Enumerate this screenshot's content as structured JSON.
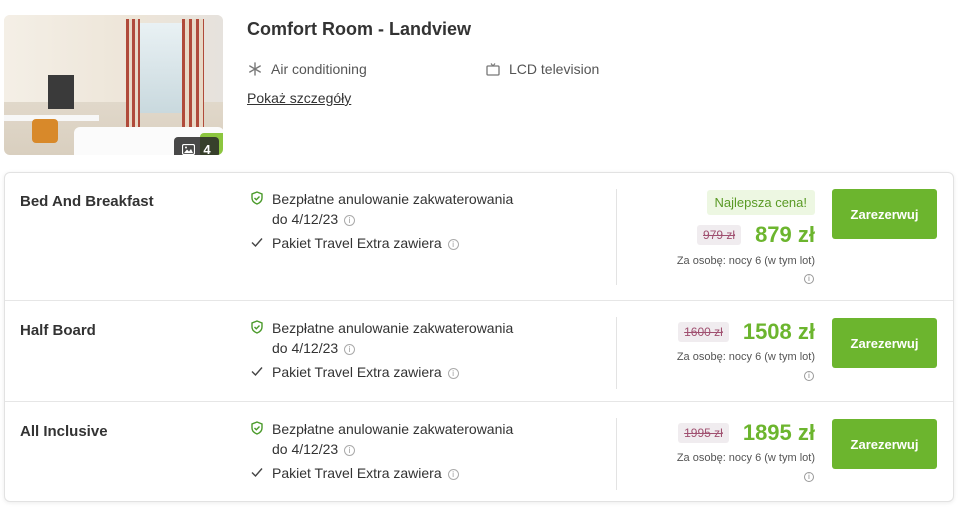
{
  "room": {
    "title": "Comfort Room - Landview",
    "photo_count": "4",
    "amenities": [
      {
        "icon": "snowflake-icon",
        "label": "Air conditioning"
      },
      {
        "icon": "tv-icon",
        "label": "LCD television"
      }
    ],
    "details_link": "Pokaż szczegóły"
  },
  "offers": [
    {
      "board": "Bed And Breakfast",
      "cancel_text": "Bezpłatne anulowanie zakwaterowania",
      "cancel_date": "do 4/12/23",
      "package_text": "Pakiet Travel Extra zawiera",
      "best_price_badge": "Najlepsza cena!",
      "old_price": "979 zł",
      "new_price": "879 zł",
      "per_person": "Za osobę: nocy 6 (w tym lot)",
      "button": "Zarezerwuj"
    },
    {
      "board": "Half Board",
      "cancel_text": "Bezpłatne anulowanie zakwaterowania",
      "cancel_date": "do 4/12/23",
      "package_text": "Pakiet Travel Extra zawiera",
      "old_price": "1600 zł",
      "new_price": "1508 zł",
      "per_person": "Za osobę: nocy 6 (w tym lot)",
      "button": "Zarezerwuj"
    },
    {
      "board": "All Inclusive",
      "cancel_text": "Bezpłatne anulowanie zakwaterowania",
      "cancel_date": "do 4/12/23",
      "package_text": "Pakiet Travel Extra zawiera",
      "old_price": "1995 zł",
      "new_price": "1895 zł",
      "per_person": "Za osobę: nocy 6 (w tym lot)",
      "button": "Zarezerwuj"
    }
  ],
  "colors": {
    "accent_green": "#6cb52e",
    "best_badge_bg": "#edf7e2",
    "old_price_bg": "#f0ecef"
  }
}
